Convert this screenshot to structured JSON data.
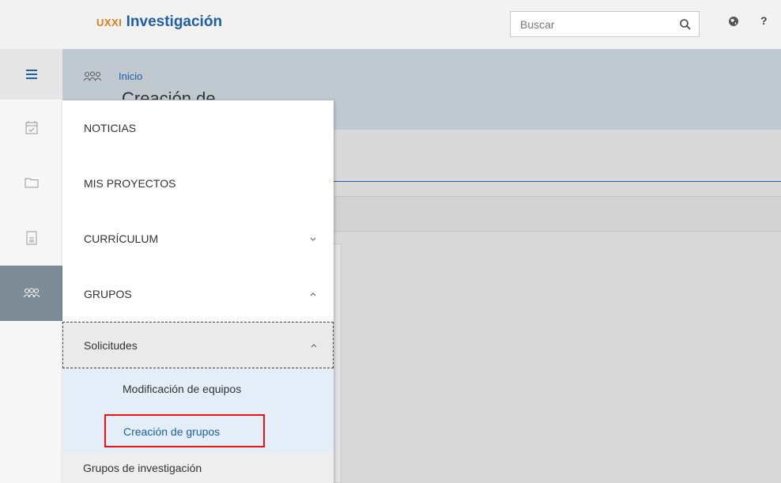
{
  "header": {
    "logo_prefix": "UXXI",
    "logo_name": "Investigación",
    "search_placeholder": "Buscar",
    "help_label": "?"
  },
  "breadcrumb": {
    "home": "Inicio"
  },
  "page": {
    "title": "Creación de"
  },
  "menu": {
    "noticias": "NOTICIAS",
    "mis_proyectos": "MIS PROYECTOS",
    "curriculum": "CURRÍCULUM",
    "grupos": "GRUPOS",
    "solicitudes": "Solicitudes",
    "modificacion": "Modificación de equipos",
    "creacion": "Creación de grupos",
    "grupos_investigacion": "Grupos de investigación"
  },
  "colors": {
    "brand_blue": "#1f5fa8",
    "brand_orange": "#e07b17",
    "active_rail": "#7c8b96",
    "highlight_border": "#ee1111"
  }
}
